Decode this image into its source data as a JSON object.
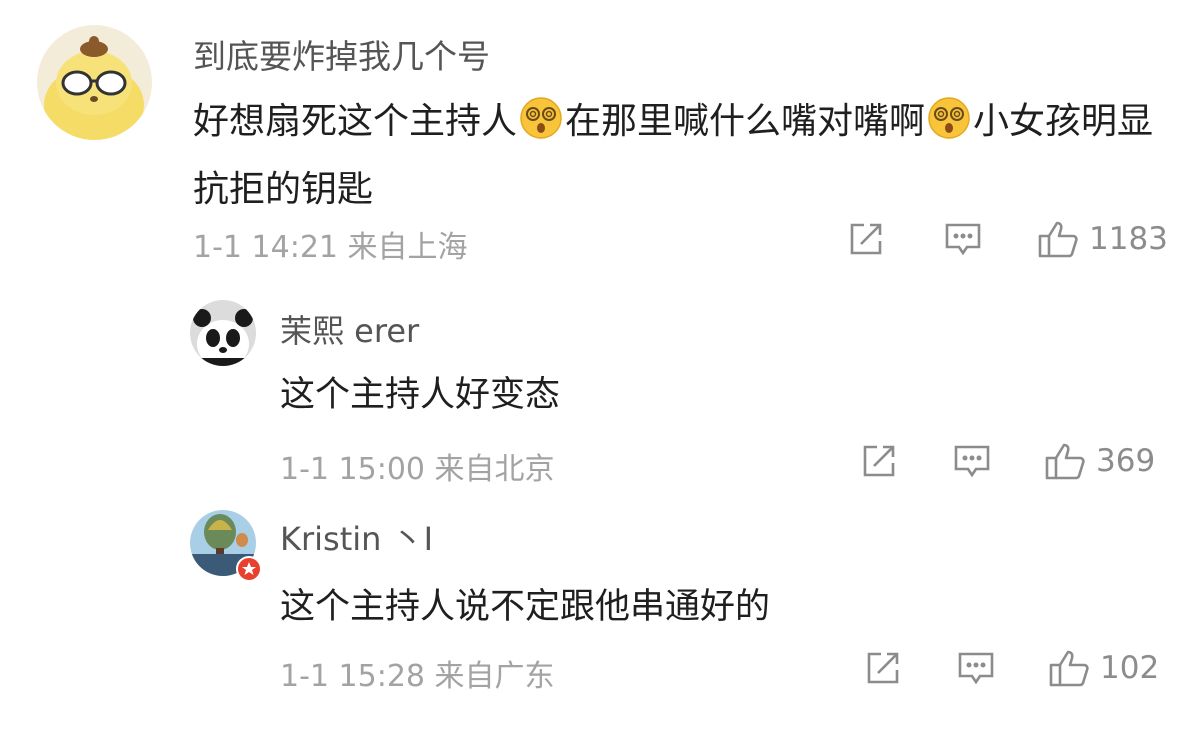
{
  "comments": [
    {
      "username": "到底要炸掉我几个号",
      "segments": [
        "好想扇死这个主持人",
        "在那里喊什么嘴对嘴啊",
        "小女孩明显抗拒的钥匙"
      ],
      "emoji": "dizzy-face-emoji",
      "meta": "1-1 14:21 来自上海",
      "likes": "1183"
    },
    {
      "username": "茉熙 erer",
      "text": "这个主持人好变态",
      "meta": "1-1 15:00 来自北京",
      "likes": "369"
    },
    {
      "username": "Kristin 丶I",
      "text": "这个主持人说不定跟他串通好的",
      "meta": "1-1 15:28 来自广东",
      "likes": "102"
    }
  ],
  "icons": {
    "share": "share-icon",
    "reply": "comment-icon",
    "like": "thumbs-up-icon"
  },
  "colors": {
    "text": "#1f1f1f",
    "username": "#555555",
    "meta": "#a3a3a3",
    "icon": "#8c8c8c",
    "badge": "#e8402f"
  }
}
